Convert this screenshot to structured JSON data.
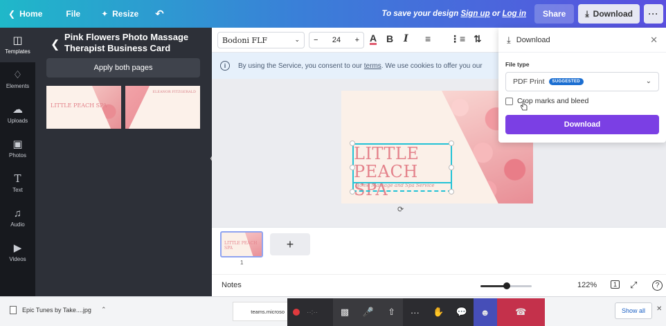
{
  "topbar": {
    "home_label": "Home",
    "file_label": "File",
    "resize_label": "Resize",
    "save_prefix": "To save your design ",
    "signup_label": "Sign up",
    "or_text": " or ",
    "login_label": "Log in",
    "share_label": "Share",
    "download_label": "Download"
  },
  "rail": {
    "templates": "Templates",
    "elements": "Elements",
    "uploads": "Uploads",
    "photos": "Photos",
    "text": "Text",
    "audio": "Audio",
    "videos": "Videos"
  },
  "panel": {
    "title": "Pink Flowers Photo Massage Therapist Business Card",
    "apply_label": "Apply both pages",
    "thumb1_text": "LITTLE PEACH SPA",
    "thumb2_text": "ELEANOR FITZGERALD"
  },
  "toolbar": {
    "font": "Bodoni FLF",
    "size": "24"
  },
  "cookie": {
    "prefix": "By using the Service, you consent to our ",
    "terms": "terms",
    "suffix": ". We use cookies to offer you our"
  },
  "card": {
    "title": "LITTLE PEACH SPA",
    "subtitle": "Home Massage and Spa Service"
  },
  "pages": {
    "page_number": "1",
    "thumb_text": "LITTLE PEACH SPA"
  },
  "notes": {
    "label": "Notes",
    "zoom": "122%",
    "zoom_percent": 122,
    "page_count": "1"
  },
  "download_panel": {
    "title": "Download",
    "file_type_label": "File type",
    "file_type_value": "PDF Print",
    "badge": "SUGGESTED",
    "crop_label": "Crop marks and bleed",
    "button_label": "Download"
  },
  "download_bar": {
    "file_name": "Epic Tunes by Take....jpg",
    "teams_tab": "teams.microso",
    "show_all": "Show all"
  },
  "colors": {
    "accent_purple": "#7b3fe4",
    "badge_blue": "#1b6ed1",
    "selection": "#22c2d6",
    "title_pink": "#e4838c"
  }
}
